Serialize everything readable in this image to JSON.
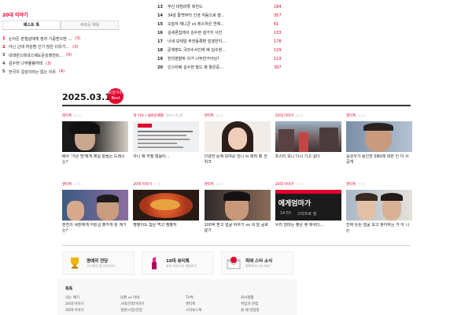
{
  "left_section": {
    "title": "20대 이야기",
    "tabs": [
      "베스트 톡",
      "새로운 배틀"
    ],
    "ranks": [
      {
        "num": "1",
        "title": "논아든 촌철살에게 정자 기증받으면 ...",
        "count": "(3)"
      },
      {
        "num": "2",
        "title": "아닌 근데 하성범 인기 많은 이유가...",
        "count": "(3)"
      },
      {
        "num": "3",
        "title": "네네만스따내스제도운상레전트...",
        "count": "(0)"
      },
      {
        "num": "4",
        "title": "김수현 나무뮬봉하테",
        "count": "(3)"
      },
      {
        "num": "5",
        "title": "한국의 걸성이라는 없는 이유",
        "count": "(4)"
      }
    ]
  },
  "right_section": {
    "more": "+ 더보기",
    "items": [
      {
        "num": "13",
        "title": "부산 비빔라튜 레전드",
        "count": "184"
      },
      {
        "num": "14",
        "title": "34살 통백부터 인생 처음으로 말...",
        "count": "357"
      },
      {
        "num": "15",
        "title": "오늘자 제니콘 vs 레스하은 연예...",
        "count": "61"
      },
      {
        "num": "16",
        "title": "김새론집에서 김수현 설거지 사진",
        "count": "133"
      },
      {
        "num": "17",
        "title": "너네 모태알 주전동록환 알겠반지...",
        "count": "178"
      },
      {
        "num": "18",
        "title": "문재장도 국리수서인에 배 김수현...",
        "count": "129"
      },
      {
        "num": "19",
        "title": "한미점말바 이거 너무한거아님?",
        "count": "119"
      },
      {
        "num": "20",
        "title": "인스타베 김수현 필드 왜 항은중...",
        "count": "397"
      }
    ]
  },
  "date_header": {
    "date": "2025.03.16",
    "badge": "오늘의판 Best"
  },
  "cards_row1": [
    {
      "cat": "엔터톡",
      "sub": "◇ ◇",
      "caption": "배우 '가온 방'에게 제일 잘될는 드레스는?",
      "thumb": "woman-closeup"
    },
    {
      "cat": "핫 이슈 / 새로운배틀",
      "sub": "19시 01분",
      "caption": "아니 왜 하필 말음이...",
      "thumb": "screenshot-text"
    },
    {
      "cat": "엔터톡",
      "sub": "◇ ◇",
      "caption": "다양한 눈에 보여준 만니 in 화려 패 션위크",
      "thumb": "woman-lightbg"
    },
    {
      "cat": "20대 이야기",
      "sub": "◇ ◇",
      "caption": "프스티 보니 다시 기고 싶다",
      "thumb": "city-street"
    },
    {
      "cat": "엔터톡",
      "sub": "◇ ◇",
      "caption": "응성우가 틀인한 SNS에 대한 인 이 사 공개",
      "thumb": "man-wince"
    }
  ],
  "cards_row2": [
    {
      "cat": "엔터톡",
      "sub": "◇ ◇",
      "caption": "혼전의 세훈에게 어린걸 출카게 된 계기는?",
      "thumb": "tv-show"
    },
    {
      "cat": "20대 이야기",
      "sub": "◇ ◇",
      "caption": "짬뽕이도 뭠은 먹고 짬뽕자",
      "thumb": "food-dish"
    },
    {
      "cat": "엔터톡",
      "sub": "◇ ◇",
      "caption": "100억 받고 얼굴 바꾸기 vs 네 얼 굴로 살기",
      "thumb": "man-portrait"
    },
    {
      "cat": "20대 이야기",
      "sub": "◇ ◇",
      "caption": "우리 엄마는 평은 좋 애위다...",
      "thumb": "text-card",
      "overlay": "에게엄마가",
      "time": "14:55",
      "brand": "스타트로 컴"
    },
    {
      "cat": "엔터톡",
      "sub": "◇ ◇",
      "caption": "진짜 튼튼 얼굴 보고 좋아하는 거 아 니는",
      "thumb": "couple"
    }
  ],
  "promos": [
    {
      "title": "명예의 전당",
      "sub": "고수들의 빛 모아보기",
      "icon": "trophy-icon"
    },
    {
      "title": "10대 뷰티톡",
      "sub": "뷰티 커뮤니티 체험하기",
      "icon": "lipstick-icon"
    },
    {
      "title": "최애 스타 소식",
      "sub": "팬톡에서 나누세요!",
      "icon": "mail-star-icon"
    }
  ],
  "footer": {
    "heading": "톡톡",
    "col1": [
      "사는 얘기",
      "20대 이야기",
      "30대 이야기"
    ],
    "col2": [
      "남편 vs 아내",
      "시댁/친정이야기",
      "결혼/시집/친정"
    ],
    "col3": [
      "TV톡",
      "엔터톡",
      "스타뉴스톡"
    ],
    "col4": [
      "회사생활",
      "취업과 면접",
      "쉴 때 영업정"
    ]
  }
}
